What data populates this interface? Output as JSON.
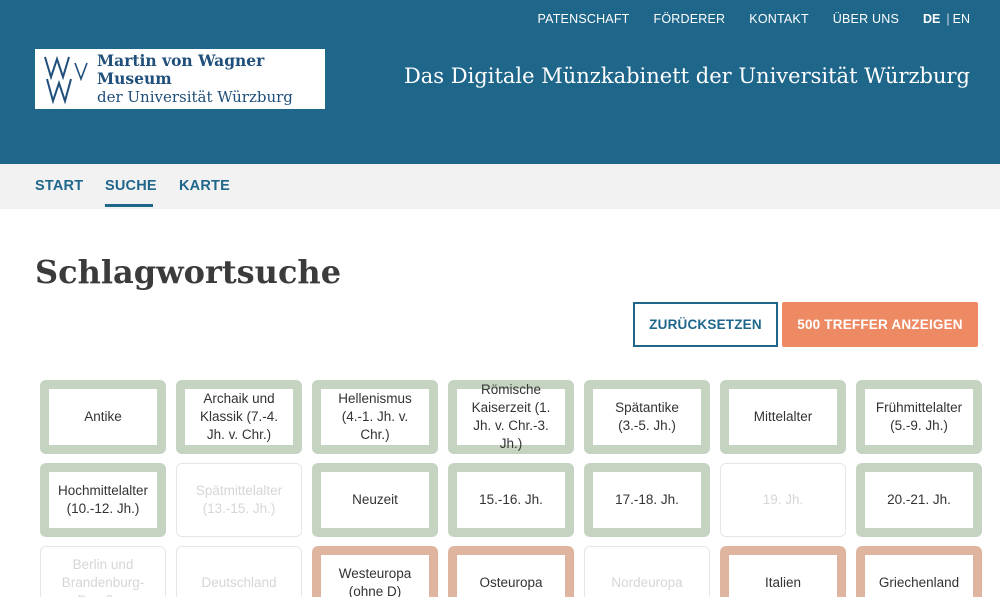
{
  "topnav": {
    "items": [
      "PATENSCHAFT",
      "FÖRDERER",
      "KONTAKT",
      "ÜBER UNS"
    ],
    "lang_de": "DE",
    "lang_sep": "|",
    "lang_en": "EN"
  },
  "logo": {
    "line1": "Martin von Wagner Museum",
    "line2": "der Universität Würzburg"
  },
  "site_title": "Das Digitale Münzkabinett der Universität Würzburg",
  "mainnav": {
    "items": [
      "START",
      "SUCHE",
      "KARTE"
    ],
    "active": "SUCHE"
  },
  "page_title": "Schlagwortsuche",
  "buttons": {
    "reset": "ZURÜCKSETZEN",
    "show": "500 TREFFER ANZEIGEN"
  },
  "tiles": [
    {
      "label": "Antike",
      "state": "green"
    },
    {
      "label": "Archaik und Klassik (7.-4. Jh. v. Chr.)",
      "state": "green"
    },
    {
      "label": "Hellenismus (4.-1. Jh. v. Chr.)",
      "state": "green"
    },
    {
      "label": "Römische Kaiserzeit (1. Jh. v. Chr.-3. Jh.)",
      "state": "green"
    },
    {
      "label": "Spätantike (3.-5. Jh.)",
      "state": "green"
    },
    {
      "label": "Mittelalter",
      "state": "green"
    },
    {
      "label": "Frühmittelalter (5.-9. Jh.)",
      "state": "green"
    },
    {
      "label": "Hochmittelalter (10.-12. Jh.)",
      "state": "green"
    },
    {
      "label": "Spätmittelalter (13.-15. Jh.)",
      "state": "disabled"
    },
    {
      "label": "Neuzeit",
      "state": "green"
    },
    {
      "label": "15.-16. Jh.",
      "state": "green"
    },
    {
      "label": "17.-18. Jh.",
      "state": "green"
    },
    {
      "label": "19. Jh.",
      "state": "disabled"
    },
    {
      "label": "20.-21. Jh.",
      "state": "green"
    },
    {
      "label": "Berlin und Brandenburg-Preußen",
      "state": "disabled"
    },
    {
      "label": "Deutschland",
      "state": "disabled"
    },
    {
      "label": "Westeuropa (ohne D)",
      "state": "orange"
    },
    {
      "label": "Osteuropa",
      "state": "orange"
    },
    {
      "label": "Nordeuropa",
      "state": "disabled"
    },
    {
      "label": "Italien",
      "state": "orange"
    },
    {
      "label": "Griechenland",
      "state": "orange"
    }
  ],
  "colors": {
    "header_bg": "#1f668b",
    "accent_orange": "#ee8a63",
    "tile_green_border": "#c5d3c1",
    "tile_orange_border": "#dfb59f"
  }
}
